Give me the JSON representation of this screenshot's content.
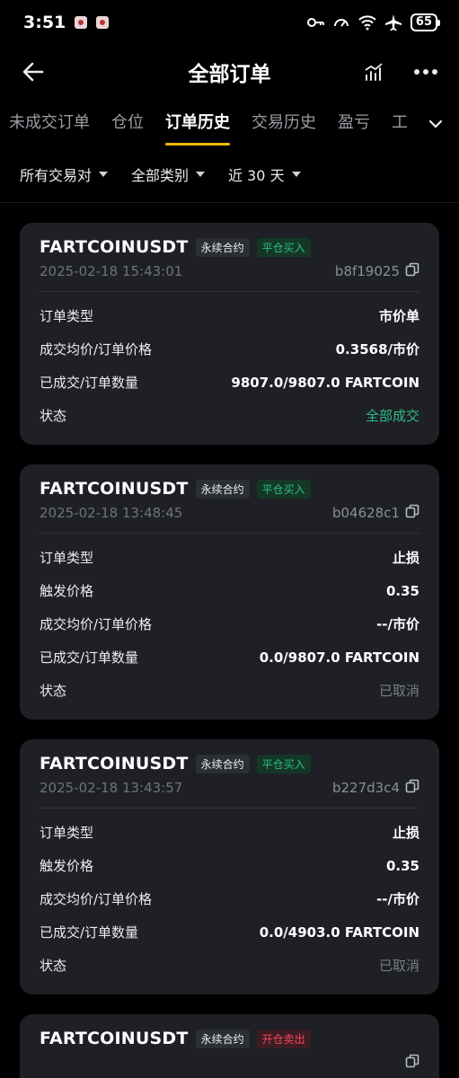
{
  "status_bar": {
    "time": "3:51",
    "battery": "65"
  },
  "header": {
    "title": "全部订单"
  },
  "tabs": [
    {
      "label": "未成交订单",
      "active": false
    },
    {
      "label": "仓位",
      "active": false
    },
    {
      "label": "订单历史",
      "active": true
    },
    {
      "label": "交易历史",
      "active": false
    },
    {
      "label": "盈亏",
      "active": false
    },
    {
      "label": "工",
      "active": false
    }
  ],
  "filters": [
    {
      "label": "所有交易对"
    },
    {
      "label": "全部类别"
    },
    {
      "label": "近 30 天"
    }
  ],
  "colors": {
    "accent": "#f0b90b",
    "buy": "#2ebd85",
    "sell": "#f6465d",
    "card": "#1e2026"
  },
  "orders": [
    {
      "symbol": "FARTCOINUSDT",
      "kind": "永续合约",
      "side": "平仓买入",
      "side_color": "green",
      "datetime": "2025-02-18 15:43:01",
      "order_id": "b8f19025",
      "rows": [
        {
          "k": "订单类型",
          "v": "市价单",
          "style": ""
        },
        {
          "k": "成交均价/订单价格",
          "v": "0.3568/市价",
          "style": ""
        },
        {
          "k": "已成交/订单数量",
          "v": "9807.0/9807.0 FARTCOIN",
          "style": ""
        },
        {
          "k": "状态",
          "v": "全部成交",
          "style": "green"
        }
      ]
    },
    {
      "symbol": "FARTCOINUSDT",
      "kind": "永续合约",
      "side": "平仓买入",
      "side_color": "green",
      "datetime": "2025-02-18 13:48:45",
      "order_id": "b04628c1",
      "rows": [
        {
          "k": "订单类型",
          "v": "止损",
          "style": ""
        },
        {
          "k": "触发价格",
          "v": "0.35",
          "style": ""
        },
        {
          "k": "成交均价/订单价格",
          "v": "--/市价",
          "style": ""
        },
        {
          "k": "已成交/订单数量",
          "v": "0.0/9807.0 FARTCOIN",
          "style": ""
        },
        {
          "k": "状态",
          "v": "已取消",
          "style": "gray"
        }
      ]
    },
    {
      "symbol": "FARTCOINUSDT",
      "kind": "永续合约",
      "side": "平仓买入",
      "side_color": "green",
      "datetime": "2025-02-18 13:43:57",
      "order_id": "b227d3c4",
      "rows": [
        {
          "k": "订单类型",
          "v": "止损",
          "style": ""
        },
        {
          "k": "触发价格",
          "v": "0.35",
          "style": ""
        },
        {
          "k": "成交均价/订单价格",
          "v": "--/市价",
          "style": ""
        },
        {
          "k": "已成交/订单数量",
          "v": "0.0/4903.0 FARTCOIN",
          "style": ""
        },
        {
          "k": "状态",
          "v": "已取消",
          "style": "gray"
        }
      ]
    },
    {
      "symbol": "FARTCOINUSDT",
      "kind": "永续合约",
      "side": "开仓卖出",
      "side_color": "red",
      "datetime": "",
      "order_id": "",
      "rows": []
    }
  ]
}
